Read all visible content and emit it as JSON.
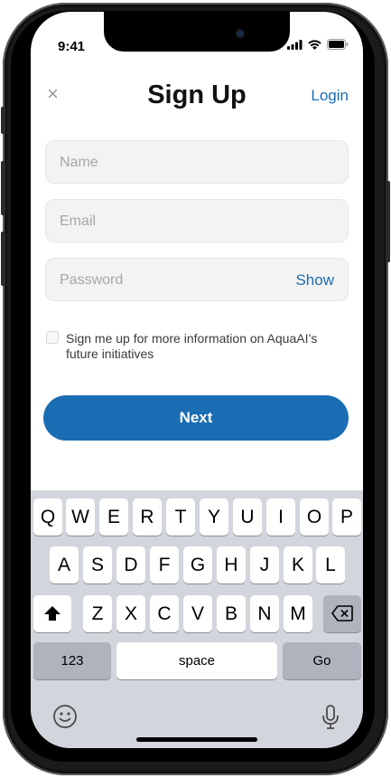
{
  "status_bar": {
    "time": "9:41"
  },
  "nav": {
    "close_icon": "×",
    "title": "Sign Up",
    "login_label": "Login"
  },
  "form": {
    "name_placeholder": "Name",
    "email_placeholder": "Email",
    "password_placeholder": "Password",
    "show_label": "Show",
    "checkbox_label": "Sign me up for more information on AquaAI’s future initiatives",
    "next_label": "Next"
  },
  "keyboard": {
    "row1": [
      "Q",
      "W",
      "E",
      "R",
      "T",
      "Y",
      "U",
      "I",
      "O",
      "P"
    ],
    "row2": [
      "A",
      "S",
      "D",
      "F",
      "G",
      "H",
      "J",
      "K",
      "L"
    ],
    "row3": [
      "Z",
      "X",
      "C",
      "V",
      "B",
      "N",
      "M"
    ],
    "numbers_label": "123",
    "space_label": "space",
    "go_label": "Go",
    "shift_icon": "shift-icon",
    "backspace_icon": "backspace-icon",
    "emoji_icon": "emoji-icon",
    "mic_icon": "microphone-icon"
  },
  "colors": {
    "accent": "#1b6db3",
    "keyboard_bg": "#d2d5db"
  }
}
